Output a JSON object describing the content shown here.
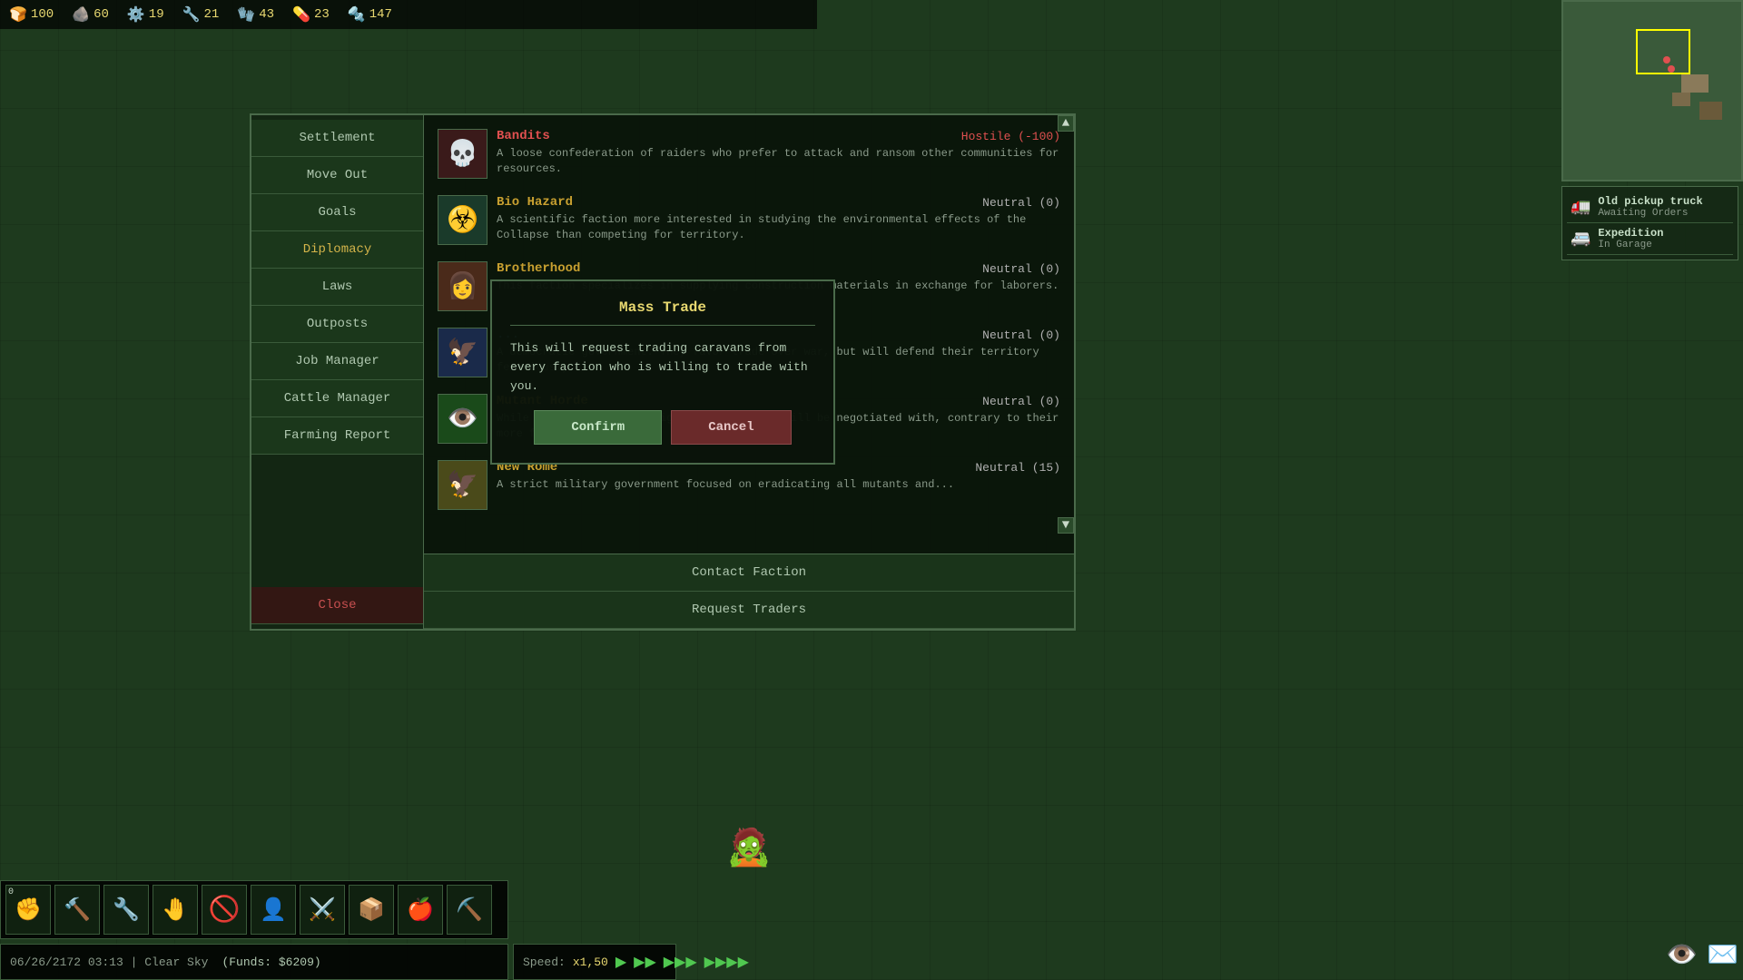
{
  "resources": {
    "food": {
      "icon": "🍞",
      "value": "100",
      "label": "food"
    },
    "stone": {
      "icon": "🪨",
      "value": "60",
      "label": "stone"
    },
    "iron": {
      "icon": "⚙️",
      "value": "19",
      "label": "iron"
    },
    "copper": {
      "icon": "🔧",
      "value": "21",
      "label": "copper"
    },
    "cloth": {
      "icon": "🧤",
      "value": "43",
      "label": "cloth"
    },
    "medicine": {
      "icon": "💊",
      "value": "23",
      "label": "medicine"
    },
    "parts": {
      "icon": "🔩",
      "value": "147",
      "label": "parts"
    }
  },
  "vehicles": [
    {
      "icon": "🚛",
      "name": "Old pickup truck",
      "status": "Awaiting Orders"
    },
    {
      "icon": "🚐",
      "name": "Expedition",
      "status": "In Garage"
    }
  ],
  "sidebar": {
    "buttons": [
      {
        "label": "Settlement",
        "active": false
      },
      {
        "label": "Move Out",
        "active": false
      },
      {
        "label": "Goals",
        "active": false
      },
      {
        "label": "Diplomacy",
        "active": true
      },
      {
        "label": "Laws",
        "active": false
      },
      {
        "label": "Outposts",
        "active": false
      },
      {
        "label": "Job Manager",
        "active": false
      },
      {
        "label": "Cattle Manager",
        "active": false
      },
      {
        "label": "Farming Report",
        "active": false
      }
    ],
    "close_label": "Close"
  },
  "factions": [
    {
      "name": "Bandits",
      "name_class": "hostile",
      "status": "Hostile (-100)",
      "status_class": "hostile",
      "portrait": "💀",
      "portrait_color": "#8a3a3a",
      "description": "A loose confederation of raiders who prefer to attack and ransom other communities for resources."
    },
    {
      "name": "Bio Hazard",
      "name_class": "neutral",
      "status": "Neutral (0)",
      "status_class": "neutral",
      "portrait": "☣️",
      "portrait_color": "#3a5a3a",
      "description": "A scientific faction more interested in studying the environmental effects of the Collapse than competing for territory."
    },
    {
      "name": "Brotherhood",
      "name_class": "neutral",
      "status": "Neutral (0)",
      "status_class": "neutral",
      "portrait": "👩",
      "portrait_color": "#6a3a3a",
      "description": "This faction specializes in supplying construction materials in exchange for laborers."
    },
    {
      "name": "...",
      "name_class": "neutral",
      "status": "Neutral (0)",
      "status_class": "neutral",
      "portrait": "🦅",
      "portrait_color": "#3a4a6a",
      "description": "A democratic government. They favor trade over war, but will defend their territory ferociously."
    },
    {
      "name": "Mutant Horde",
      "name_class": "neutral",
      "status": "Neutral (0)",
      "status_class": "neutral",
      "portrait": "👁️",
      "portrait_color": "#2a5a2a",
      "description": "While aggressive, those big green guys can still be negotiated with, contrary to their more feral brothers."
    },
    {
      "name": "New Rome",
      "name_class": "neutral",
      "status": "Neutral (15)",
      "status_class": "neutral",
      "portrait": "🦅",
      "portrait_color": "#8a7a2a",
      "description": "A strict military government focused on eradicating all mutants and..."
    }
  ],
  "dialog": {
    "title": "Mass Trade",
    "text": "This will request trading caravans from every faction who is willing to trade with you.",
    "confirm_label": "Confirm",
    "cancel_label": "Cancel"
  },
  "bottom_buttons": [
    {
      "label": "Contact Faction"
    },
    {
      "label": "Request Traders"
    }
  ],
  "status_bar": {
    "datetime": "06/26/2172 03:13",
    "weather": "Clear Sky",
    "funds": "(Funds: $6209)"
  },
  "speed": {
    "label": "Speed:",
    "value": "x1,50",
    "btn1": "▶",
    "btn2": "▶▶",
    "btn3": "▶▶▶",
    "btn4": "▶▶▶▶"
  },
  "action_bar": {
    "counter": "0",
    "buttons": [
      "✊",
      "🔨",
      "🔧",
      "🤚",
      "🚫",
      "👤",
      "⚔️",
      "📦",
      "🍎",
      "⛏️"
    ]
  }
}
